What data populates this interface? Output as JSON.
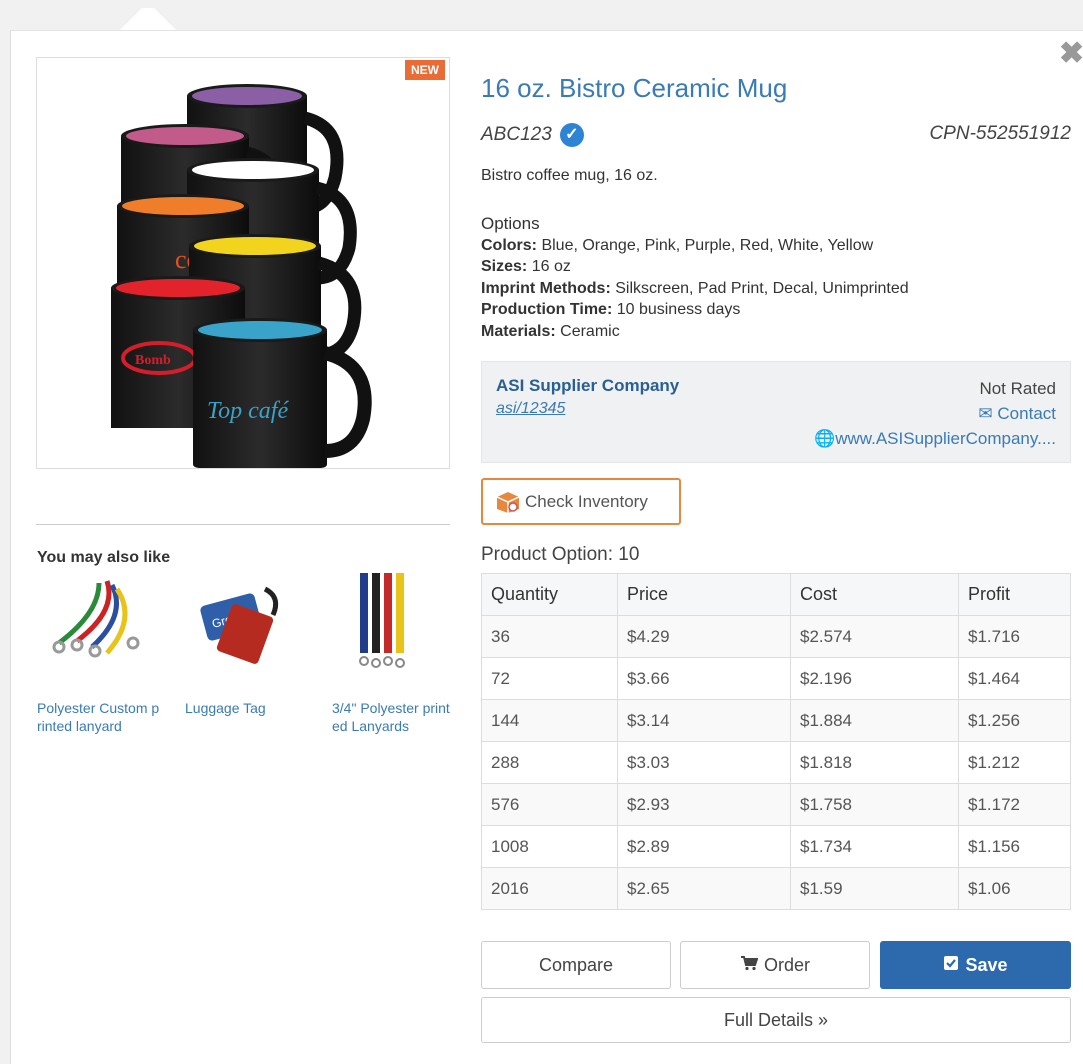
{
  "product": {
    "title": "16 oz. Bistro Ceramic Mug",
    "sku": "ABC123",
    "cpn": "CPN-552551912",
    "description": "Bistro coffee mug, 16 oz.",
    "badge": "NEW",
    "mug_colors": [
      "#8a5fa6",
      "#c25a8a",
      "#ffffff",
      "#f07d2a",
      "#f2d41f",
      "#e3232b",
      "#3aa3c9"
    ],
    "mug_print_texts": [
      "Top café",
      "Bomb"
    ]
  },
  "options": {
    "heading": "Options",
    "colors_label": "Colors:",
    "colors_value": " Blue, Orange, Pink, Purple, Red, White, Yellow",
    "sizes_label": "Sizes:",
    "sizes_value": " 16 oz",
    "imprint_label": "Imprint Methods:",
    "imprint_value": " Silkscreen, Pad Print, Decal, Unimprinted",
    "production_label": "Production Time:",
    "production_value": " 10 business days",
    "materials_label": "Materials:",
    "materials_value": " Ceramic"
  },
  "supplier": {
    "name": "ASI Supplier Company",
    "asi_id": "asi/12345 ",
    "rating": "Not Rated",
    "contact": "Contact",
    "website": "www.ASISupplierCompany...."
  },
  "check_inventory": "Check Inventory",
  "product_option_label": "Product Option: 10",
  "pricing": {
    "headers": [
      "Quantity",
      "Price",
      "Cost",
      "Profit"
    ],
    "rows": [
      [
        "36",
        "$4.29",
        "$2.574",
        "$1.716"
      ],
      [
        "72",
        "$3.66",
        "$2.196",
        "$1.464"
      ],
      [
        "144",
        "$3.14",
        "$1.884",
        "$1.256"
      ],
      [
        "288",
        "$3.03",
        "$1.818",
        "$1.212"
      ],
      [
        "576",
        "$2.93",
        "$1.758",
        "$1.172"
      ],
      [
        "1008",
        "$2.89",
        "$1.734",
        "$1.156"
      ],
      [
        "2016",
        "$2.65",
        "$1.59",
        "$1.06"
      ]
    ]
  },
  "related": {
    "title": "You may also like",
    "items": [
      {
        "label": "Polyester Custom printed lanyard"
      },
      {
        "label": "Luggage Tag"
      },
      {
        "label": "3/4\" Polyester printed Lanyards"
      }
    ],
    "luggage_tag_text": "Group"
  },
  "actions": {
    "compare": "Compare",
    "order": "Order",
    "save": "Save",
    "full_details": "Full Details »"
  },
  "icons": {
    "close": "close-icon",
    "verified": "check-circle-icon",
    "contact": "envelope-icon",
    "website": "globe-icon",
    "inventory": "box-icon",
    "order": "cart-icon",
    "save": "save-icon"
  },
  "colors": {
    "link": "#3a7bb5",
    "save_button": "#2d69ad",
    "badge": "#e96c36",
    "inventory_border": "#e6893f"
  }
}
